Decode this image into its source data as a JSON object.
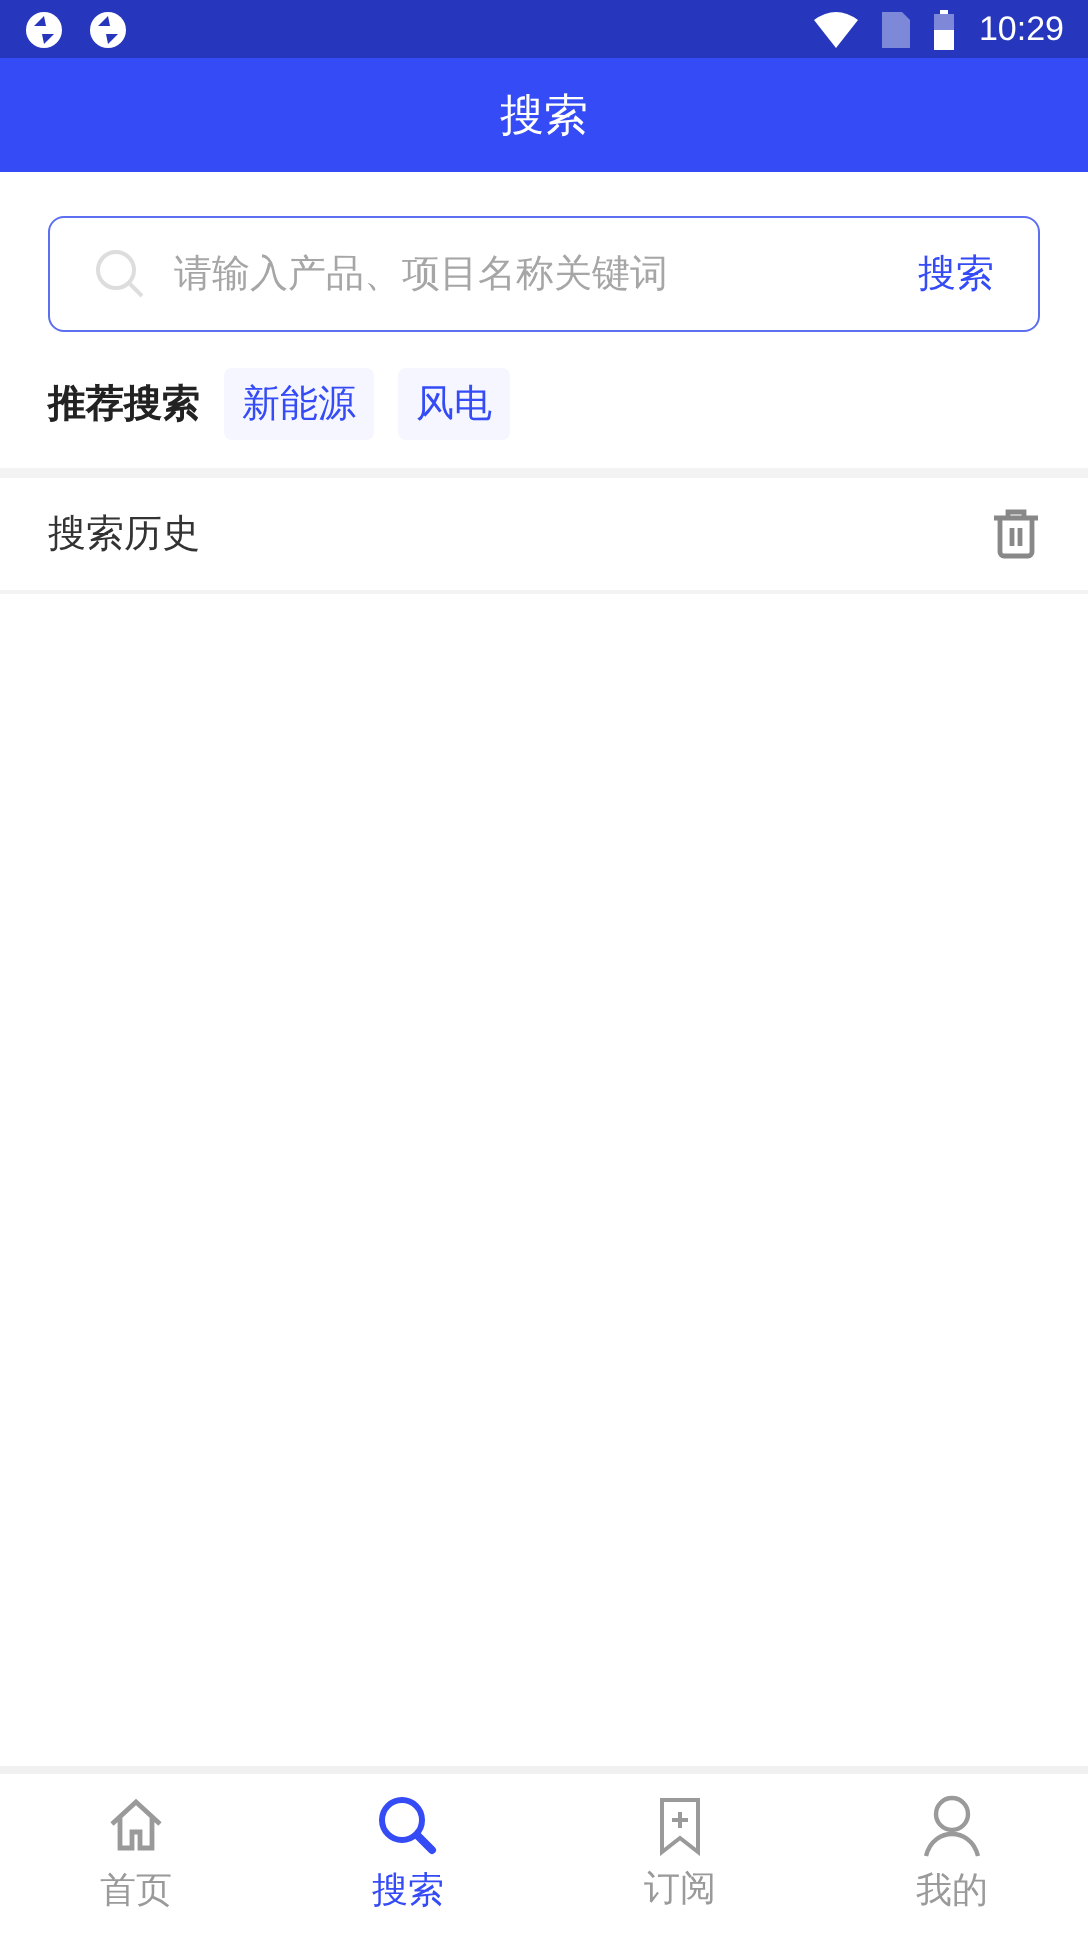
{
  "status_bar": {
    "time": "10:29"
  },
  "header": {
    "title": "搜索"
  },
  "search": {
    "placeholder": "请输入产品、项目名称关键词",
    "button": "搜索"
  },
  "recommended": {
    "label": "推荐搜索",
    "tags": [
      "新能源",
      "风电"
    ]
  },
  "history": {
    "title": "搜索历史"
  },
  "tabs": [
    {
      "label": "首页",
      "kind": "home",
      "selected": false
    },
    {
      "label": "搜索",
      "kind": "search",
      "selected": true
    },
    {
      "label": "订阅",
      "kind": "subscribe",
      "selected": false
    },
    {
      "label": "我的",
      "kind": "profile",
      "selected": false
    }
  ]
}
